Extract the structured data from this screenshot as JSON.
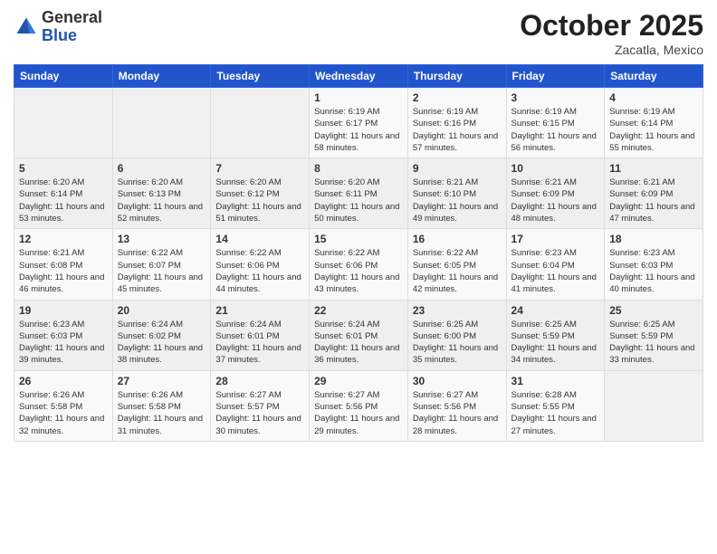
{
  "header": {
    "logo_general": "General",
    "logo_blue": "Blue",
    "month_title": "October 2025",
    "location": "Zacatla, Mexico"
  },
  "days_of_week": [
    "Sunday",
    "Monday",
    "Tuesday",
    "Wednesday",
    "Thursday",
    "Friday",
    "Saturday"
  ],
  "weeks": [
    [
      {
        "day": "",
        "info": ""
      },
      {
        "day": "",
        "info": ""
      },
      {
        "day": "",
        "info": ""
      },
      {
        "day": "1",
        "info": "Sunrise: 6:19 AM\nSunset: 6:17 PM\nDaylight: 11 hours and 58 minutes."
      },
      {
        "day": "2",
        "info": "Sunrise: 6:19 AM\nSunset: 6:16 PM\nDaylight: 11 hours and 57 minutes."
      },
      {
        "day": "3",
        "info": "Sunrise: 6:19 AM\nSunset: 6:15 PM\nDaylight: 11 hours and 56 minutes."
      },
      {
        "day": "4",
        "info": "Sunrise: 6:19 AM\nSunset: 6:14 PM\nDaylight: 11 hours and 55 minutes."
      }
    ],
    [
      {
        "day": "5",
        "info": "Sunrise: 6:20 AM\nSunset: 6:14 PM\nDaylight: 11 hours and 53 minutes."
      },
      {
        "day": "6",
        "info": "Sunrise: 6:20 AM\nSunset: 6:13 PM\nDaylight: 11 hours and 52 minutes."
      },
      {
        "day": "7",
        "info": "Sunrise: 6:20 AM\nSunset: 6:12 PM\nDaylight: 11 hours and 51 minutes."
      },
      {
        "day": "8",
        "info": "Sunrise: 6:20 AM\nSunset: 6:11 PM\nDaylight: 11 hours and 50 minutes."
      },
      {
        "day": "9",
        "info": "Sunrise: 6:21 AM\nSunset: 6:10 PM\nDaylight: 11 hours and 49 minutes."
      },
      {
        "day": "10",
        "info": "Sunrise: 6:21 AM\nSunset: 6:09 PM\nDaylight: 11 hours and 48 minutes."
      },
      {
        "day": "11",
        "info": "Sunrise: 6:21 AM\nSunset: 6:09 PM\nDaylight: 11 hours and 47 minutes."
      }
    ],
    [
      {
        "day": "12",
        "info": "Sunrise: 6:21 AM\nSunset: 6:08 PM\nDaylight: 11 hours and 46 minutes."
      },
      {
        "day": "13",
        "info": "Sunrise: 6:22 AM\nSunset: 6:07 PM\nDaylight: 11 hours and 45 minutes."
      },
      {
        "day": "14",
        "info": "Sunrise: 6:22 AM\nSunset: 6:06 PM\nDaylight: 11 hours and 44 minutes."
      },
      {
        "day": "15",
        "info": "Sunrise: 6:22 AM\nSunset: 6:06 PM\nDaylight: 11 hours and 43 minutes."
      },
      {
        "day": "16",
        "info": "Sunrise: 6:22 AM\nSunset: 6:05 PM\nDaylight: 11 hours and 42 minutes."
      },
      {
        "day": "17",
        "info": "Sunrise: 6:23 AM\nSunset: 6:04 PM\nDaylight: 11 hours and 41 minutes."
      },
      {
        "day": "18",
        "info": "Sunrise: 6:23 AM\nSunset: 6:03 PM\nDaylight: 11 hours and 40 minutes."
      }
    ],
    [
      {
        "day": "19",
        "info": "Sunrise: 6:23 AM\nSunset: 6:03 PM\nDaylight: 11 hours and 39 minutes."
      },
      {
        "day": "20",
        "info": "Sunrise: 6:24 AM\nSunset: 6:02 PM\nDaylight: 11 hours and 38 minutes."
      },
      {
        "day": "21",
        "info": "Sunrise: 6:24 AM\nSunset: 6:01 PM\nDaylight: 11 hours and 37 minutes."
      },
      {
        "day": "22",
        "info": "Sunrise: 6:24 AM\nSunset: 6:01 PM\nDaylight: 11 hours and 36 minutes."
      },
      {
        "day": "23",
        "info": "Sunrise: 6:25 AM\nSunset: 6:00 PM\nDaylight: 11 hours and 35 minutes."
      },
      {
        "day": "24",
        "info": "Sunrise: 6:25 AM\nSunset: 5:59 PM\nDaylight: 11 hours and 34 minutes."
      },
      {
        "day": "25",
        "info": "Sunrise: 6:25 AM\nSunset: 5:59 PM\nDaylight: 11 hours and 33 minutes."
      }
    ],
    [
      {
        "day": "26",
        "info": "Sunrise: 6:26 AM\nSunset: 5:58 PM\nDaylight: 11 hours and 32 minutes."
      },
      {
        "day": "27",
        "info": "Sunrise: 6:26 AM\nSunset: 5:58 PM\nDaylight: 11 hours and 31 minutes."
      },
      {
        "day": "28",
        "info": "Sunrise: 6:27 AM\nSunset: 5:57 PM\nDaylight: 11 hours and 30 minutes."
      },
      {
        "day": "29",
        "info": "Sunrise: 6:27 AM\nSunset: 5:56 PM\nDaylight: 11 hours and 29 minutes."
      },
      {
        "day": "30",
        "info": "Sunrise: 6:27 AM\nSunset: 5:56 PM\nDaylight: 11 hours and 28 minutes."
      },
      {
        "day": "31",
        "info": "Sunrise: 6:28 AM\nSunset: 5:55 PM\nDaylight: 11 hours and 27 minutes."
      },
      {
        "day": "",
        "info": ""
      }
    ]
  ]
}
